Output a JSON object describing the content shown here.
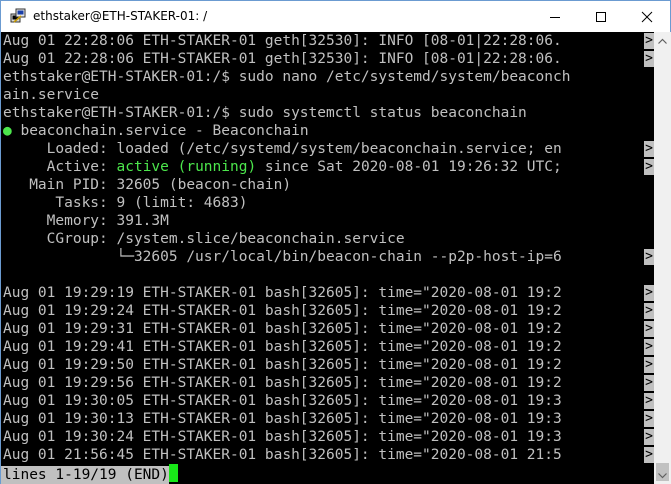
{
  "window": {
    "title": "ethstaker@ETH-STAKER-01: /",
    "icon": "putty-icon",
    "controls": [
      "minimize-icon",
      "maximize-icon",
      "close-icon"
    ]
  },
  "colors": {
    "terminal_bg": "#000000",
    "terminal_fg": "#c0c0c0",
    "active_green": "#4ce64c",
    "cursor": "#18e818"
  },
  "terminal": {
    "lines": [
      {
        "text": "Aug 01 22:28:06 ETH-STAKER-01 geth[32530]: INFO [08-01|22:28:06.",
        "truncated": true
      },
      {
        "text": "Aug 01 22:28:06 ETH-STAKER-01 geth[32530]: INFO [08-01|22:28:06.",
        "truncated": true
      },
      {
        "text": "ethstaker@ETH-STAKER-01:/$ sudo nano /etc/systemd/system/beaconch",
        "truncated": false
      },
      {
        "text": "ain.service",
        "truncated": false
      },
      {
        "text": "ethstaker@ETH-STAKER-01:/$ sudo systemctl status beaconchain",
        "truncated": false
      },
      {
        "prefix": "●",
        "text": " beaconchain.service - Beaconchain",
        "truncated": false
      },
      {
        "text": "     Loaded: loaded (/etc/systemd/system/beaconchain.service; en",
        "truncated": true
      },
      {
        "pre": "     Active: ",
        "green": "active (running)",
        "post": " since Sat 2020-08-01 19:26:32 UTC;",
        "truncated": true
      },
      {
        "text": "   Main PID: 32605 (beacon-chain)",
        "truncated": false
      },
      {
        "text": "      Tasks: 9 (limit: 4683)",
        "truncated": false
      },
      {
        "text": "     Memory: 391.3M",
        "truncated": false
      },
      {
        "text": "     CGroup: /system.slice/beaconchain.service",
        "truncated": false
      },
      {
        "text": "             └─32605 /usr/local/bin/beacon-chain --p2p-host-ip=6",
        "truncated": true
      },
      {
        "text": "",
        "truncated": false
      },
      {
        "text": "Aug 01 19:29:19 ETH-STAKER-01 bash[32605]: time=\"2020-08-01 19:2",
        "truncated": true
      },
      {
        "text": "Aug 01 19:29:24 ETH-STAKER-01 bash[32605]: time=\"2020-08-01 19:2",
        "truncated": true
      },
      {
        "text": "Aug 01 19:29:31 ETH-STAKER-01 bash[32605]: time=\"2020-08-01 19:2",
        "truncated": true
      },
      {
        "text": "Aug 01 19:29:41 ETH-STAKER-01 bash[32605]: time=\"2020-08-01 19:2",
        "truncated": true
      },
      {
        "text": "Aug 01 19:29:50 ETH-STAKER-01 bash[32605]: time=\"2020-08-01 19:2",
        "truncated": true
      },
      {
        "text": "Aug 01 19:29:56 ETH-STAKER-01 bash[32605]: time=\"2020-08-01 19:2",
        "truncated": true
      },
      {
        "text": "Aug 01 19:30:05 ETH-STAKER-01 bash[32605]: time=\"2020-08-01 19:3",
        "truncated": true
      },
      {
        "text": "Aug 01 19:30:13 ETH-STAKER-01 bash[32605]: time=\"2020-08-01 19:3",
        "truncated": true
      },
      {
        "text": "Aug 01 19:30:24 ETH-STAKER-01 bash[32605]: time=\"2020-08-01 19:3",
        "truncated": true
      },
      {
        "text": "Aug 01 21:56:45 ETH-STAKER-01 bash[32605]: time=\"2020-08-01 21:5",
        "truncated": true
      }
    ],
    "truncation_marker": ">",
    "status": "lines 1-19/19 (END)"
  }
}
